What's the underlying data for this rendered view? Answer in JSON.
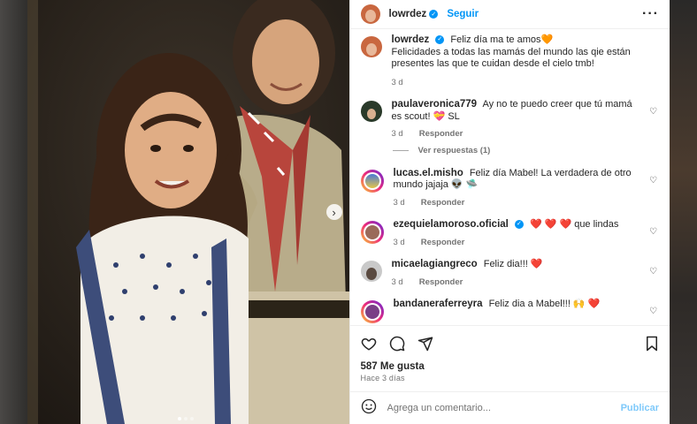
{
  "colors": {
    "accent": "#0095f6",
    "heart": "#ed4956",
    "text": "#262626",
    "muted": "#737373"
  },
  "post": {
    "author": "lowrdez",
    "follow_label": "Seguir",
    "caption_line1": "Feliz día ma te amos🧡",
    "caption_line2": "Felicidades a todas las mamás del mundo las qie están presentes las que te cuidan desde el cielo tmb!",
    "caption_time": "3 d"
  },
  "comments": [
    {
      "user": "paulaveronica779",
      "text": "Ay no te puedo creer que tú mamá es scout! 💝 SL",
      "time": "3 d",
      "reply": "Responder"
    },
    {
      "user": "lucas.el.misho",
      "text": "Feliz día Mabel! La verdadera de otro mundo jajaja 👽 🛸",
      "time": "3 d",
      "reply": "Responder"
    },
    {
      "user": "ezequielamoroso.oficial",
      "text": "❤️ ❤️ ❤️  que lindas",
      "time": "3 d",
      "reply": "Responder"
    },
    {
      "user": "micaelagiangreco",
      "text": "Feliz dia!!! ❤️",
      "time": "3 d",
      "reply": "Responder"
    },
    {
      "user": "bandaneraferreyra",
      "text": "Feliz dia a Mabel!!! 🙌 ❤️",
      "time": "",
      "reply": ""
    }
  ],
  "view_replies": "Ver respuestas (1)",
  "likes": "587 Me gusta",
  "posted_ago": "Hace 3 días",
  "add_comment": {
    "placeholder": "Agrega un comentario...",
    "publish_label": "Publicar"
  },
  "icons": {
    "more": "more-icon",
    "next": "chevron-right-icon",
    "like": "heart-icon",
    "comment": "comment-icon",
    "share": "share-icon",
    "save": "bookmark-icon",
    "emoji": "emoji-icon",
    "verified": "verified-icon"
  },
  "carousel": {
    "slide_count": 3,
    "active_index": 0
  }
}
